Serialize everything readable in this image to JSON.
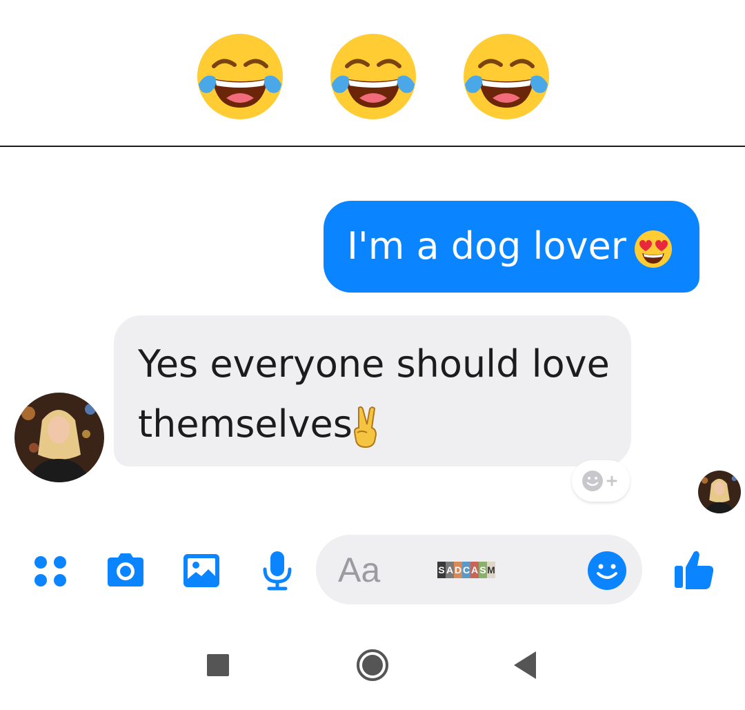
{
  "emoji_strip": {
    "icons": [
      "face-with-tears-of-joy",
      "face-with-tears-of-joy",
      "face-with-tears-of-joy"
    ]
  },
  "conversation": {
    "outgoing_message": {
      "text": "I'm a dog lover",
      "emoji": "smiling-face-with-heart-eyes"
    },
    "incoming_message": {
      "line1": "Yes everyone should love",
      "line2": "themselves",
      "emoji": "victory-hand"
    },
    "reaction_button_icon": "add-reaction-icon"
  },
  "composer": {
    "placeholder": "Aa",
    "watermark": "SADCASM",
    "tools": [
      "menu-icon",
      "camera-icon",
      "gallery-icon",
      "microphone-icon"
    ],
    "emoji_button_icon": "smiley-icon",
    "send_button_icon": "thumbs-up-icon"
  },
  "navigation": {
    "buttons": [
      "recents-button",
      "home-button",
      "back-button"
    ]
  },
  "colors": {
    "accent": "#0a84ff",
    "incoming_bubble": "#efeff1",
    "emoji_yellow": "#ffcc33",
    "tear_blue": "#4aa8e8"
  }
}
